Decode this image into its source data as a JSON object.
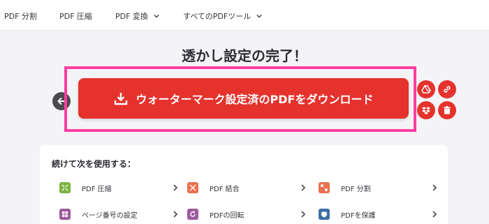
{
  "nav": {
    "items": [
      {
        "label": "PDF 分割"
      },
      {
        "label": "PDF 圧縮"
      },
      {
        "label": "PDF 変換"
      },
      {
        "label": "すべてのPDFツール"
      }
    ]
  },
  "main": {
    "title": "透かし設定の完了！",
    "download_button": "ウォーターマーク設定済のPDFをダウンロード"
  },
  "continue": {
    "heading": "続けて次を使用する：",
    "tools": [
      {
        "label": "PDF 圧縮",
        "icon": "compress-icon",
        "color": "#7cb342"
      },
      {
        "label": "PDF 結合",
        "icon": "merge-icon",
        "color": "#e8714f"
      },
      {
        "label": "PDF 分割",
        "icon": "split-icon",
        "color": "#e8714f"
      },
      {
        "label": "ページ番号の設定",
        "icon": "page-numbers-icon",
        "color": "#9c5a9e"
      },
      {
        "label": "PDFの回転",
        "icon": "rotate-icon",
        "color": "#9c5a9e"
      },
      {
        "label": "PDFを保護",
        "icon": "shield-icon",
        "color": "#3d6fa8"
      }
    ]
  },
  "colors": {
    "accent": "#e5322d",
    "highlight": "#ff3ea0"
  }
}
